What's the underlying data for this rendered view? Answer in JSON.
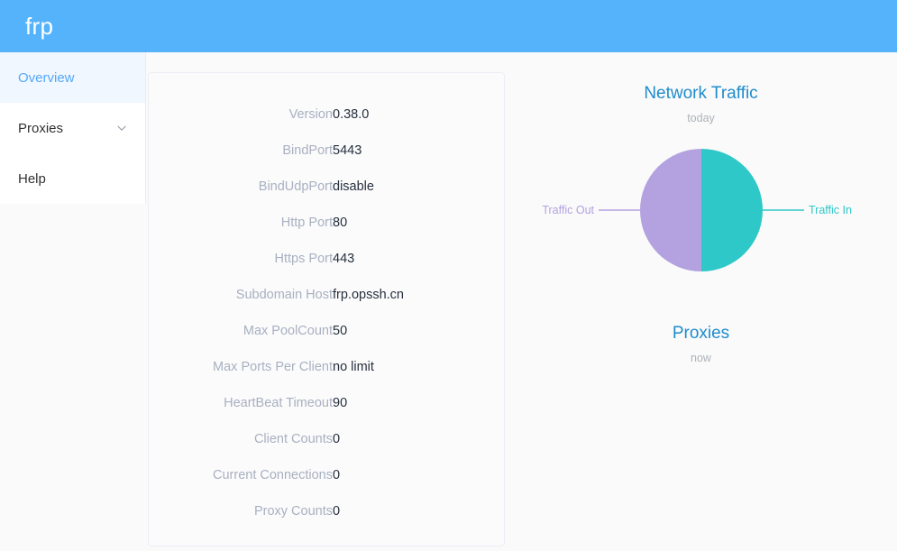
{
  "header": {
    "brand": "frp"
  },
  "sidebar": {
    "items": [
      {
        "label": "Overview",
        "name": "overview",
        "active": true,
        "has_chevron": false
      },
      {
        "label": "Proxies",
        "name": "proxies",
        "active": false,
        "has_chevron": true
      },
      {
        "label": "Help",
        "name": "help",
        "active": false,
        "has_chevron": false
      }
    ]
  },
  "server_info": {
    "rows": [
      {
        "label": "Version",
        "value": "0.38.0"
      },
      {
        "label": "BindPort",
        "value": "5443"
      },
      {
        "label": "BindUdpPort",
        "value": "disable"
      },
      {
        "label": "Http Port",
        "value": "80"
      },
      {
        "label": "Https Port",
        "value": "443"
      },
      {
        "label": "Subdomain Host",
        "value": "frp.opssh.cn"
      },
      {
        "label": "Max PoolCount",
        "value": "50"
      },
      {
        "label": "Max Ports Per Client",
        "value": "no limit"
      },
      {
        "label": "HeartBeat Timeout",
        "value": "90"
      },
      {
        "label": "Client Counts",
        "value": "0"
      },
      {
        "label": "Current Connections",
        "value": "0"
      },
      {
        "label": "Proxy Counts",
        "value": "0"
      }
    ]
  },
  "charts": {
    "network_traffic": {
      "title": "Network Traffic",
      "subtitle": "today",
      "label_out": "Traffic Out",
      "label_in": "Traffic In"
    },
    "proxies": {
      "title": "Proxies",
      "subtitle": "now"
    }
  },
  "colors": {
    "header_blue": "#55b3fb",
    "accent_blue": "#1f8ccc",
    "nav_active_text": "#54a8fa",
    "nav_active_bg": "#f0f7fe",
    "traffic_out_purple": "#b3a1e0",
    "traffic_in_teal": "#2fc8c8",
    "label_gray": "#a8b0c0",
    "value_dark": "#26303d",
    "page_bg": "#fafafa"
  },
  "chart_data": [
    {
      "type": "pie",
      "title": "Network Traffic",
      "subtitle": "today",
      "labels": [
        "Traffic Out",
        "Traffic In"
      ],
      "values": [
        50,
        50
      ],
      "colors": [
        "#b3a1e0",
        "#2fc8c8"
      ],
      "legend": "outside-labels",
      "start_angle_deg": 0,
      "units": "percent"
    },
    {
      "type": "pie",
      "title": "Proxies",
      "subtitle": "now",
      "labels": [],
      "values": [],
      "colors": [],
      "legend": "none",
      "note": "no data rendered"
    }
  ]
}
